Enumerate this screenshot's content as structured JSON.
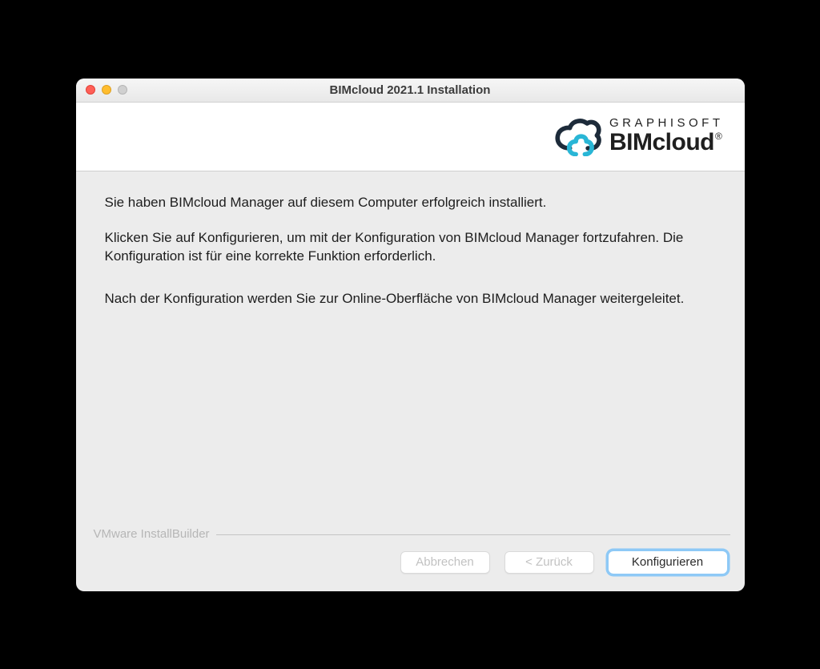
{
  "window": {
    "title": "BIMcloud 2021.1 Installation"
  },
  "logo": {
    "brand_top": "GRAPHISOFT",
    "brand_main": "BIMcloud",
    "registered": "®"
  },
  "content": {
    "p1": "Sie haben BIMcloud Manager auf diesem Computer erfolgreich installiert.",
    "p2": "Klicken Sie auf Konfigurieren, um mit der Konfiguration von BIMcloud Manager fortzufahren. Die Konfiguration ist für eine korrekte Funktion erforderlich.",
    "p3": "Nach der Konfiguration werden Sie zur Online-Oberfläche von BIMcloud Manager weitergeleitet."
  },
  "footer": {
    "builder": "VMware InstallBuilder",
    "buttons": {
      "cancel": "Abbrechen",
      "back": "< Zurück",
      "configure": "Konfigurieren"
    }
  }
}
